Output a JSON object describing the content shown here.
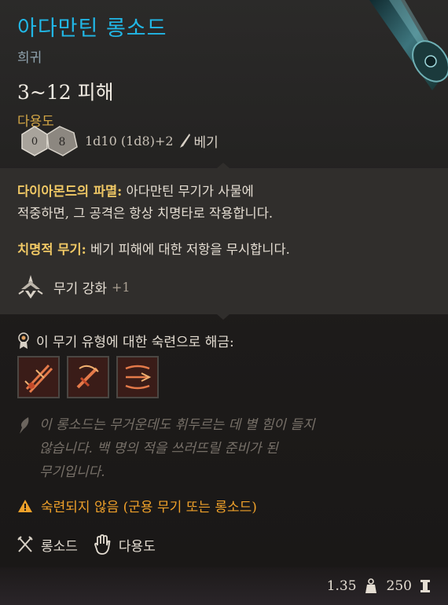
{
  "item": {
    "name": "아다만틴 롱소드",
    "rarity": "희귀",
    "damage": "3~12 피해",
    "weapon_type": "다용도"
  },
  "dice": {
    "die1": "0",
    "die2": "8",
    "formula": "1d10 (1d8)+2",
    "damage_type": "베기"
  },
  "passives": [
    {
      "name": "다이아몬드의 파멸:",
      "desc_line1": " 아다만틴 무기가 사물에",
      "desc_line2": "적중하면, 그 공격은 항상 치명타로 작용합니다."
    },
    {
      "name": "치명적 무기:",
      "desc_line1": " 베기 피해에 대한 저항을 무시합니다."
    }
  ],
  "upgrade": {
    "label": "무기 강화",
    "value": "+1"
  },
  "proficiency": {
    "title": "이 무기 유형에 대한 숙련으로 해금:"
  },
  "flavor": [
    "이 롱소드는 무거운데도 휘두르는 데 별 힘이 들지",
    "않습니다. 백 명의 적을 쓰러뜨릴 준비가 된",
    "무기입니다."
  ],
  "warning": "숙련되지 않음 (군용 무기 또는 롱소드)",
  "properties": [
    "롱소드",
    "다용도"
  ],
  "footer": {
    "weight": "1.35",
    "price": "250"
  },
  "colors": {
    "name": "#21b7e6",
    "keyword": "#f0c865",
    "warning": "#f0a12a",
    "weapon_type": "#d3a646"
  }
}
